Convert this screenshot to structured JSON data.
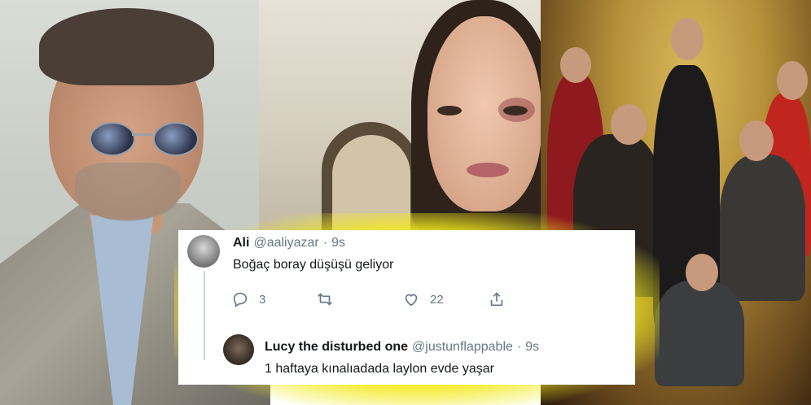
{
  "colors": {
    "highlight_yellow": "#f2ea1e",
    "tweet_text": "#14171a",
    "tweet_muted": "#657786",
    "thread_line": "#ccd6dd"
  },
  "photos": [
    {
      "subject": "man-with-round-sunglasses"
    },
    {
      "subject": "woman-with-bruised-face"
    },
    {
      "subject": "cast-poster"
    }
  ],
  "tweets": {
    "main": {
      "avatar_icon": "user-avatar",
      "name": "Ali",
      "handle": "@aaliyazar",
      "separator": "·",
      "time": "9s",
      "text": "Boğaç boray düşüşü geliyor",
      "actions": {
        "reply": {
          "icon": "reply-icon",
          "count": "3"
        },
        "retweet": {
          "icon": "retweet-icon",
          "count": ""
        },
        "like": {
          "icon": "heart-icon",
          "count": "22"
        },
        "share": {
          "icon": "share-icon",
          "count": ""
        }
      }
    },
    "reply": {
      "avatar_icon": "user-avatar",
      "name": "Lucy the disturbed one",
      "handle": "@justunflappable",
      "separator": "·",
      "time": "9s",
      "text": "1 haftaya kınalıadada laylon evde yaşar"
    }
  }
}
